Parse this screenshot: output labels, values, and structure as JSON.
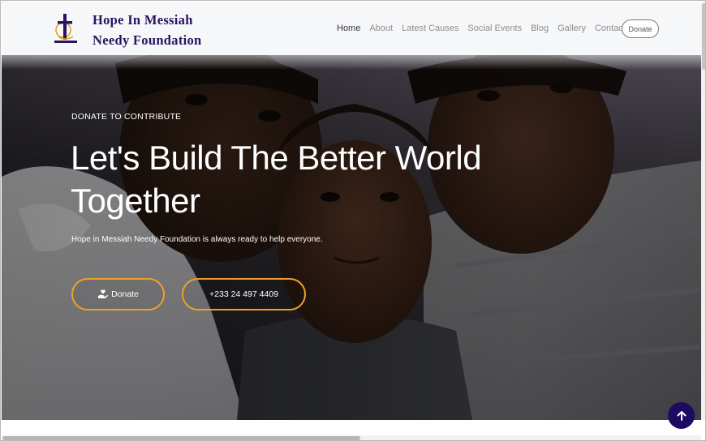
{
  "brand": {
    "line1": "Hope In Messiah",
    "line2": "Needy Foundation"
  },
  "nav": {
    "items": [
      {
        "label": "Home",
        "active": true
      },
      {
        "label": "About"
      },
      {
        "label": "Latest Causes"
      },
      {
        "label": "Social Events"
      },
      {
        "label": "Blog"
      },
      {
        "label": "Gallery"
      },
      {
        "label": "Contact"
      }
    ],
    "donate_label": "Donate"
  },
  "hero": {
    "kicker": "DONATE TO CONTRIBUTE",
    "headline": "Let's Build The Better World Together",
    "subtext": "Hope in Messiah Needy Foundation is always ready to help everyone.",
    "donate_button": "Donate",
    "phone_button": "+233 24 497 4409"
  },
  "icons": {
    "donate": "hand-holding-heart-icon",
    "scroll_top": "arrow-up-icon",
    "logo": "cross-logo-icon"
  },
  "colors": {
    "brand_text": "#2a1460",
    "accent_orange": "#f0a02a",
    "scroll_button": "#1f0a63"
  }
}
